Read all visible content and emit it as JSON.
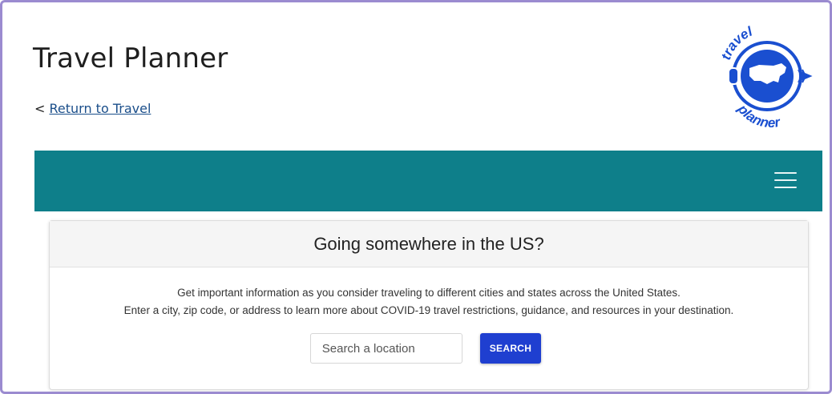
{
  "header": {
    "title": "Travel Planner",
    "return_prefix": "<",
    "return_link": "Return to Travel"
  },
  "logo": {
    "top_text": "travel",
    "bottom_text": "planner",
    "brand_color": "#1a4fd0"
  },
  "navbar": {
    "color": "#0e7f8a",
    "menu_icon": "hamburger-menu-icon"
  },
  "card": {
    "heading": "Going somewhere in the US?",
    "description_line1": "Get important information as you consider traveling to different cities and states across the United States.",
    "description_line2": "Enter a city, zip code, or address to learn more about COVID-19 travel restrictions, guidance, and resources in your destination.",
    "search_placeholder": "Search a location",
    "search_button": "SEARCH",
    "button_color": "#1f3fd0"
  }
}
